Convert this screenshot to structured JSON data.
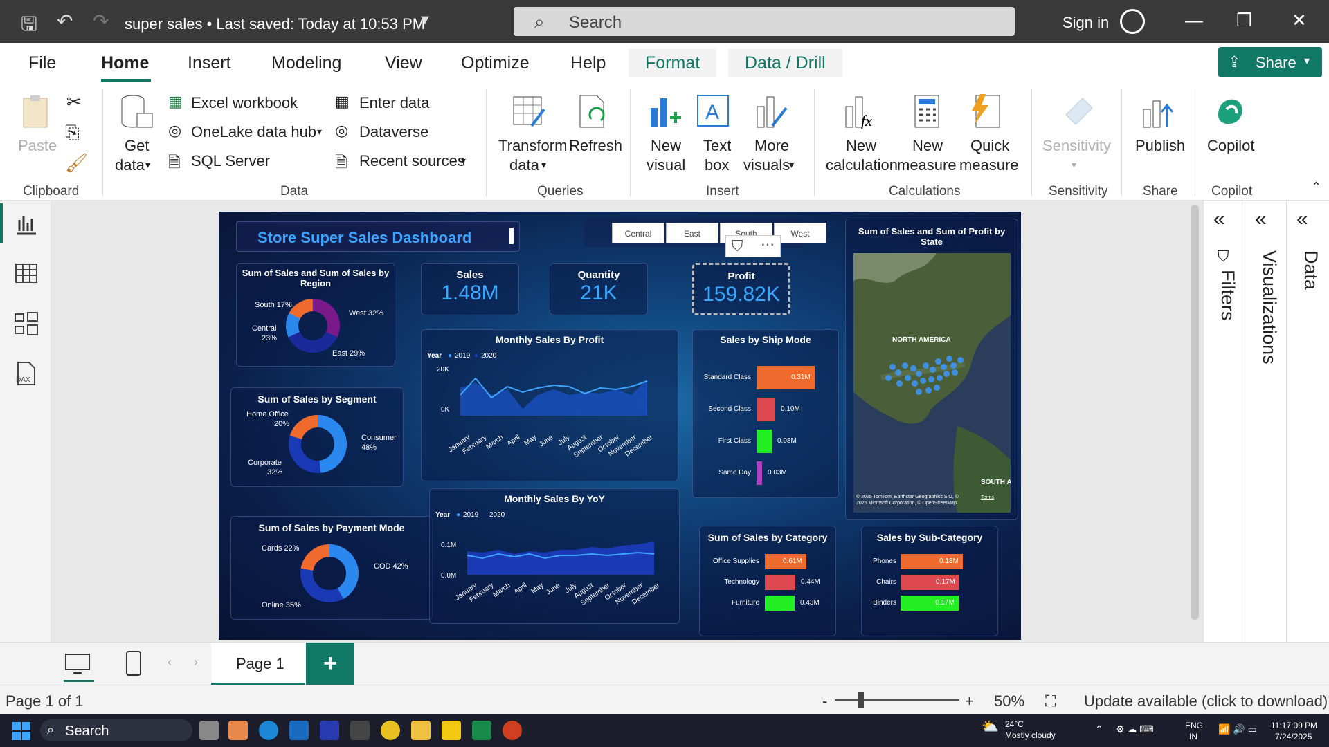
{
  "titlebar": {
    "doc_title": "super sales • Last saved: Today at 10:53 PM",
    "search_placeholder": "Search",
    "sign_in": "Sign in"
  },
  "menu": {
    "file": "File",
    "home": "Home",
    "insert": "Insert",
    "modeling": "Modeling",
    "view": "View",
    "optimize": "Optimize",
    "help": "Help",
    "format": "Format",
    "data_drill": "Data / Drill",
    "share": "Share"
  },
  "ribbon": {
    "paste": "Paste",
    "clipboard": "Clipboard",
    "get_data": "Get",
    "get_data2": "data",
    "excel": "Excel workbook",
    "onelake": "OneLake data hub",
    "sql": "SQL Server",
    "enter_data": "Enter data",
    "dataverse": "Dataverse",
    "recent": "Recent sources",
    "data": "Data",
    "transform": "Transform",
    "transform2": "data",
    "refresh": "Refresh",
    "queries": "Queries",
    "new_visual": "New",
    "new_visual2": "visual",
    "text_box": "Text",
    "text_box2": "box",
    "more_visuals": "More",
    "more_visuals2": "visuals",
    "insert": "Insert",
    "new_calc": "New",
    "new_calc2": "calculation",
    "new_measure": "New",
    "new_measure2": "measure",
    "quick_measure": "Quick",
    "quick_measure2": "measure",
    "calculations": "Calculations",
    "sensitivity": "Sensitivity",
    "sensitivity_grp": "Sensitivity",
    "publish": "Publish",
    "share_grp": "Share",
    "copilot": "Copilot",
    "copilot_grp": "Copilot"
  },
  "dashboard": {
    "title": "Store  Super Sales Dashboard",
    "slicer": [
      "Central",
      "East",
      "South",
      "West"
    ],
    "kpi": [
      {
        "label": "Sales",
        "value": "1.48M"
      },
      {
        "label": "Quantity",
        "value": "21K"
      },
      {
        "label": "Profit",
        "value": "159.82K"
      }
    ],
    "region": {
      "title": "Sum of Sales and Sum of Sales by Region",
      "labels": [
        "South 17%",
        "West 32%",
        "Central 23%",
        "East 29%"
      ],
      "central_pct": "23%",
      "central_name": "Central"
    },
    "segment": {
      "title": "Sum of Sales by Segment",
      "labels": [
        "Home Office",
        "20%",
        "Consumer",
        "48%",
        "Corporate",
        "32%"
      ]
    },
    "payment": {
      "title": "Sum of Sales by Payment Mode",
      "labels": [
        "Cards 22%",
        "COD 42%",
        "Online 35%"
      ]
    },
    "monthly_profit": {
      "title": "Monthly Sales By Profit",
      "legend_year": "Year",
      "y2019": "2019",
      "y2020": "2020",
      "yticks": [
        "20K",
        "0K"
      ]
    },
    "monthly_yoy": {
      "title": "Monthly Sales By YoY",
      "legend_year": "Year",
      "y2019": "2019",
      "y2020": "2020",
      "yticks": [
        "0.1M",
        "0.0M"
      ]
    },
    "months": [
      "January",
      "February",
      "March",
      "April",
      "May",
      "June",
      "July",
      "August",
      "September",
      "October",
      "November",
      "December"
    ],
    "ship_mode": {
      "title": "Sales by Ship Mode",
      "rows": [
        {
          "name": "Standard Class",
          "value": "0.31M",
          "frac": 1.0,
          "color": "#ef6a2d"
        },
        {
          "name": "Second Class",
          "value": "0.10M",
          "frac": 0.32,
          "color": "#e04850"
        },
        {
          "name": "First Class",
          "value": "0.08M",
          "frac": 0.26,
          "color": "#22ee22"
        },
        {
          "name": "Same Day",
          "value": "0.03M",
          "frac": 0.1,
          "color": "#b040c0"
        }
      ]
    },
    "map": {
      "title": "Sum of Sales and Sum of Profit by State",
      "na_label": "NORTH AMERICA",
      "sa_label": "SOUTH A",
      "credit": "© 2025 TomTom, Earthstar Geographics SIO, © 2025 Microsoft Corporation, © OpenStreetMap",
      "terms": "Terms"
    },
    "category": {
      "title": "Sum of Sales by Category",
      "rows": [
        {
          "name": "Office Supplies",
          "value": "0.61M",
          "frac": 1.0,
          "color": "#ef6a2d"
        },
        {
          "name": "Technology",
          "value": "0.44M",
          "frac": 0.73,
          "color": "#e04850"
        },
        {
          "name": "Furniture",
          "value": "0.43M",
          "frac": 0.71,
          "color": "#22ee22"
        }
      ]
    },
    "subcategory": {
      "title": "Sales by Sub-Category",
      "rows": [
        {
          "name": "Phones",
          "value": "0.18M",
          "frac": 1.0,
          "color": "#ef6a2d"
        },
        {
          "name": "Chairs",
          "value": "0.17M",
          "frac": 0.94,
          "color": "#e04850"
        },
        {
          "name": "Binders",
          "value": "0.17M",
          "frac": 0.93,
          "color": "#22ee22"
        }
      ]
    }
  },
  "panes": {
    "filters": "Filters",
    "visualizations": "Visualizations",
    "data": "Data"
  },
  "pages": {
    "page1": "Page 1"
  },
  "status": {
    "page": "Page 1 of 1",
    "zoom": "50%",
    "update": "Update available (click to download)"
  },
  "taskbar": {
    "search": "Search",
    "temp": "24°C",
    "weather": "Mostly cloudy",
    "lang1": "ENG",
    "lang2": "IN",
    "time": "11:17:09 PM",
    "date": "7/24/2025"
  }
}
